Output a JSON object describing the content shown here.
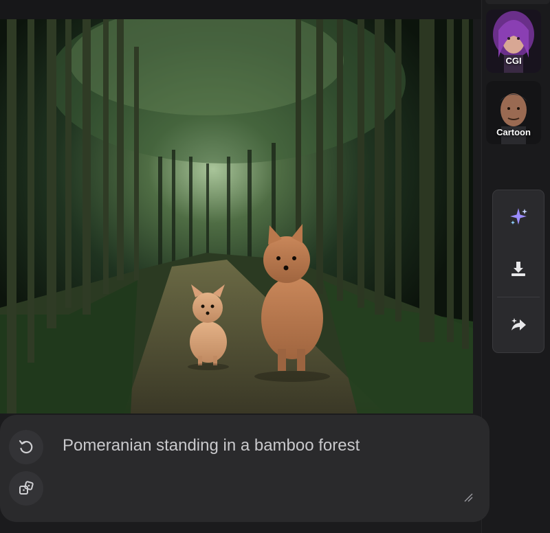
{
  "styles": [
    {
      "label": "CGI",
      "icon": "cgi-avatar-thumbnail"
    },
    {
      "label": "Cartoon",
      "icon": "cartoon-avatar-thumbnail"
    }
  ],
  "tools": [
    {
      "name": "enhance",
      "icon": "sparkle-icon"
    },
    {
      "name": "download",
      "icon": "download-icon"
    },
    {
      "name": "share",
      "icon": "share-sparkle-icon"
    }
  ],
  "prompt": {
    "text": "Pomeranian standing in a bamboo forest"
  },
  "actions": [
    {
      "name": "regenerate",
      "icon": "refresh-icon"
    },
    {
      "name": "random",
      "icon": "dice-icon"
    }
  ],
  "image": {
    "subject": "generated-image"
  },
  "colors": {
    "background": "#1b1b1d",
    "panel": "#2a2a2c",
    "accent_sparkle": "#8a7cff"
  }
}
